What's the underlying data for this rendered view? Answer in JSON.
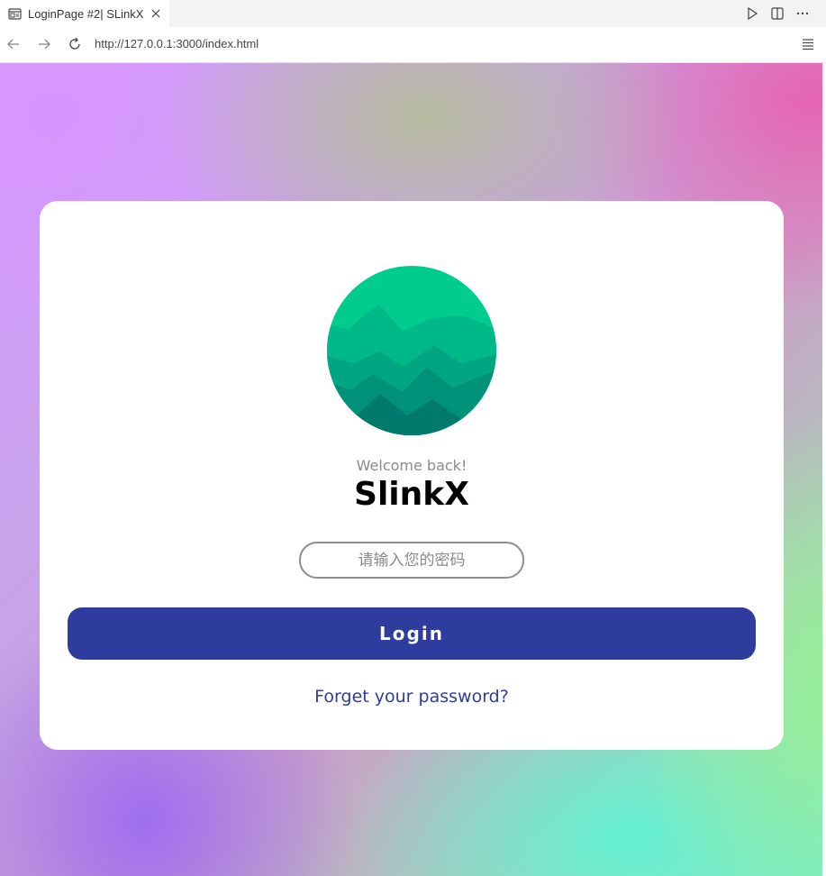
{
  "browser": {
    "tab_title": "LoginPage #2| SLinkX",
    "url": "http://127.0.0.1:3000/index.html",
    "icons": [
      "browser-page-icon",
      "close-icon",
      "run-icon",
      "split-editor-icon",
      "more-icon",
      "back-icon",
      "forward-icon",
      "reload-icon",
      "menu-icon"
    ]
  },
  "login": {
    "welcome": "Welcome back!",
    "brand": "SlinkX",
    "password_placeholder": "请输入您的密码",
    "login_label": "Login",
    "forgot_label": "Forget your password?"
  },
  "colors": {
    "primary": "#2e3c9e",
    "logo_top": "#00cc8e",
    "logo_bottom": "#007a6c"
  }
}
